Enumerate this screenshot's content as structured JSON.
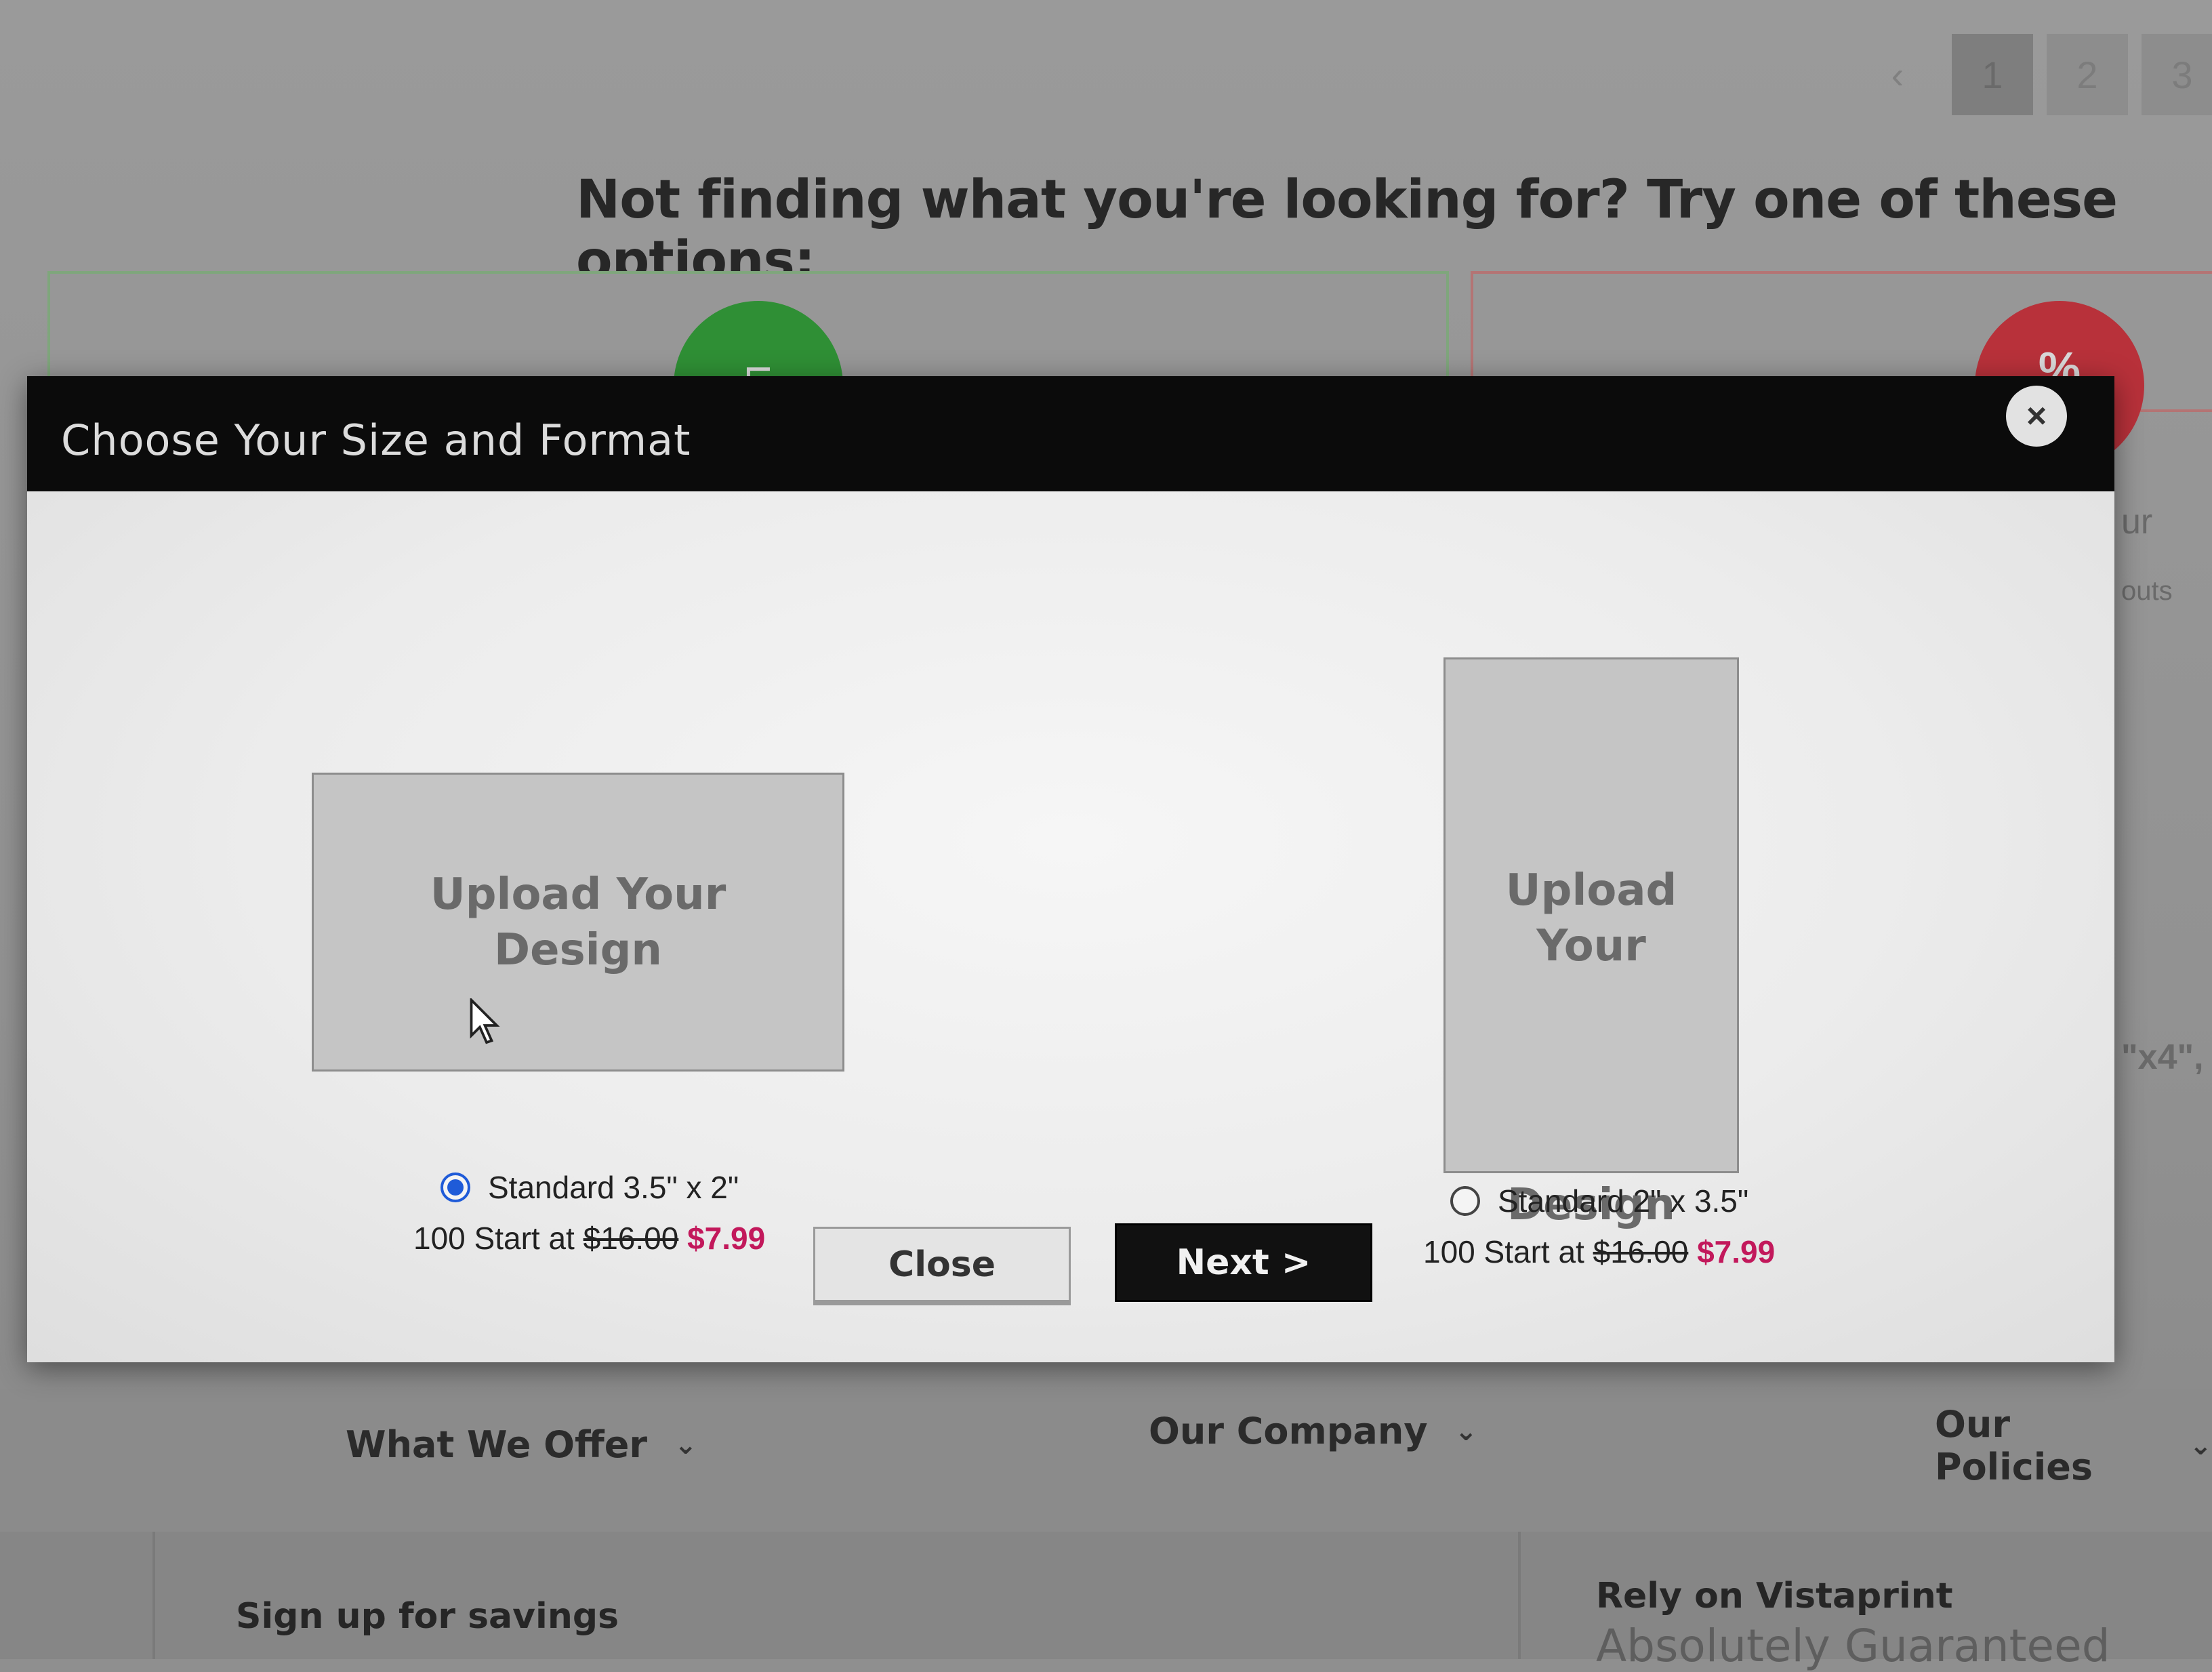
{
  "background": {
    "pagination": [
      "‹",
      "1",
      "2",
      "3"
    ],
    "heading": "Not finding what you're looking for? Try one of these options:",
    "side_fragments": [
      "ur",
      "outs",
      "\"x4\","
    ],
    "footer": {
      "menus": [
        {
          "label": "What We Offer"
        },
        {
          "label": "Our Company"
        },
        {
          "label": "Our Policies"
        }
      ],
      "signup": "Sign up for savings",
      "rely_title": "Rely on Vistaprint",
      "rely_sub": "Absolutely Guaranteed"
    }
  },
  "modal": {
    "title": "Choose Your Size and Format",
    "close_icon": "×",
    "options": [
      {
        "upload_line1": "Upload Your",
        "upload_line2": "Design",
        "label": "Standard 3.5\" x 2\"",
        "price_prefix": "100 Start at",
        "price_old": "$16.00",
        "price_new": "$7.99",
        "selected": true
      },
      {
        "upload_line1": "Upload Your",
        "upload_line2": "Design",
        "label": "Standard 2\" x 3.5\"",
        "price_prefix": "100 Start at",
        "price_old": "$16.00",
        "price_new": "$7.99",
        "selected": false
      }
    ],
    "buttons": {
      "close_label": "Close",
      "next_label": "Next >"
    }
  },
  "colors": {
    "accent_price": "#c2185b",
    "radio_selected": "#1f5bd8",
    "header_bg": "#0b0b0b"
  }
}
